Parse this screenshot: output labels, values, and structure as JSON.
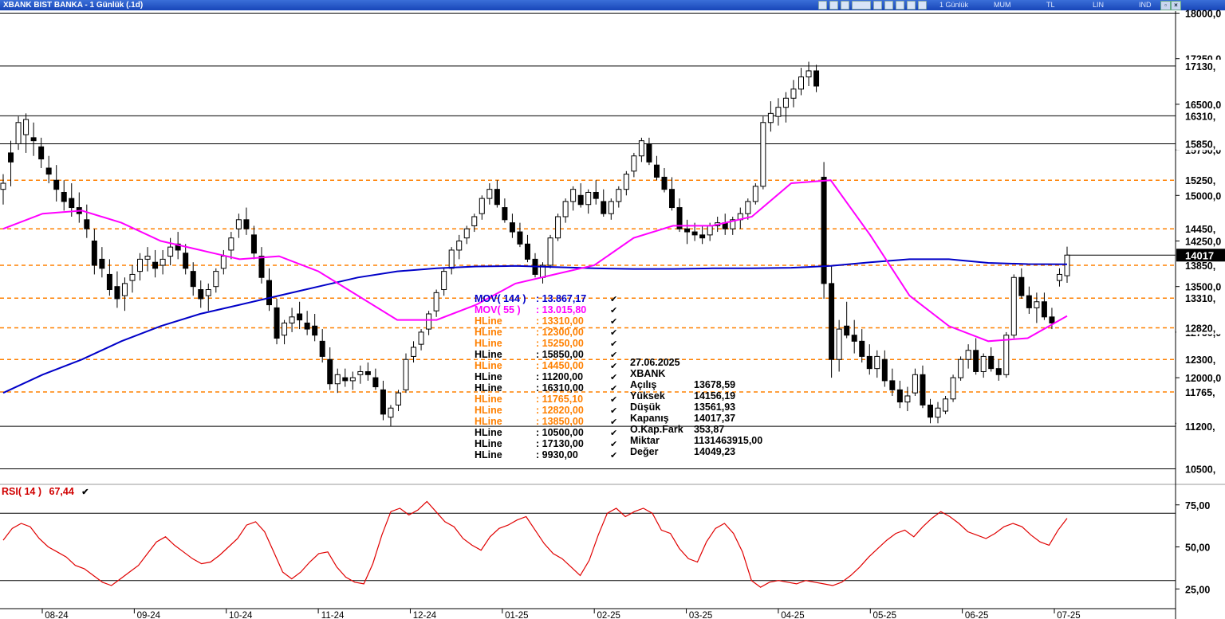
{
  "window": {
    "title": "XBANK BIST BANKA - 1 Günlük (.1d)",
    "options": [
      "1 Günlük",
      "MUM",
      "TL",
      "LIN",
      "IND"
    ]
  },
  "chart_data": [
    {
      "type": "candlestick",
      "symbol": "XBANK",
      "scale": {
        "min": 10200,
        "max": 18000
      },
      "price_ticks": [
        "18000,0",
        "17250,0",
        "16500,0",
        "15750,0",
        "15000,0",
        "14250,0",
        "13500,0",
        "12750,0",
        "12000,0",
        "11250,0"
      ],
      "x_ticks": [
        "08-24",
        "09-24",
        "10-24",
        "11-24",
        "12-24",
        "01-25",
        "02-25",
        "03-25",
        "04-25",
        "05-25",
        "06-25",
        "07-25"
      ],
      "last_price_label": "14017",
      "ohlc": [
        [
          15100,
          15350,
          14850,
          15200
        ],
        [
          15700,
          15900,
          15150,
          15550
        ],
        [
          15850,
          16300,
          15750,
          16200
        ],
        [
          16000,
          16350,
          15700,
          16250
        ],
        [
          15950,
          16200,
          15650,
          15900
        ],
        [
          15800,
          15950,
          15450,
          15600
        ],
        [
          15450,
          15650,
          15200,
          15350
        ],
        [
          15250,
          15500,
          14900,
          15100
        ],
        [
          15050,
          15250,
          14750,
          14900
        ],
        [
          14950,
          15200,
          14650,
          14800
        ],
        [
          14800,
          15050,
          14550,
          14700
        ],
        [
          14600,
          14850,
          14300,
          14450
        ],
        [
          14250,
          14450,
          13700,
          13850
        ],
        [
          13950,
          14150,
          13650,
          13800
        ],
        [
          13700,
          13950,
          13350,
          13450
        ],
        [
          13500,
          13750,
          13150,
          13300
        ],
        [
          13350,
          13650,
          13100,
          13550
        ],
        [
          13600,
          13850,
          13400,
          13700
        ],
        [
          13750,
          14050,
          13600,
          13950
        ],
        [
          13950,
          14150,
          13750,
          14000
        ],
        [
          13900,
          14100,
          13650,
          13800
        ],
        [
          13850,
          14100,
          13700,
          13950
        ],
        [
          14000,
          14300,
          13850,
          14150
        ],
        [
          14200,
          14400,
          13950,
          14100
        ],
        [
          14050,
          14200,
          13700,
          13800
        ],
        [
          13750,
          13900,
          13350,
          13500
        ],
        [
          13450,
          13600,
          13150,
          13300
        ],
        [
          13350,
          13550,
          13100,
          13450
        ],
        [
          13500,
          13800,
          13400,
          13750
        ],
        [
          13800,
          14100,
          13700,
          14000
        ],
        [
          14100,
          14400,
          13950,
          14300
        ],
        [
          14450,
          14700,
          14300,
          14600
        ],
        [
          14600,
          14800,
          14350,
          14450
        ],
        [
          14350,
          14500,
          13950,
          14050
        ],
        [
          14000,
          14150,
          13550,
          13650
        ],
        [
          13600,
          13800,
          13100,
          13200
        ],
        [
          13150,
          13300,
          12550,
          12650
        ],
        [
          12700,
          12950,
          12550,
          12900
        ],
        [
          12900,
          13150,
          12750,
          13000
        ],
        [
          13050,
          13250,
          12800,
          12950
        ],
        [
          12900,
          13100,
          12700,
          12800
        ],
        [
          12850,
          13050,
          12600,
          12700
        ],
        [
          12600,
          12800,
          12250,
          12350
        ],
        [
          12300,
          12500,
          11800,
          11900
        ],
        [
          11900,
          12150,
          11750,
          12050
        ],
        [
          12000,
          12150,
          11850,
          11950
        ],
        [
          11950,
          12100,
          11800,
          12000
        ],
        [
          12050,
          12200,
          11900,
          12100
        ],
        [
          12100,
          12250,
          11950,
          12050
        ],
        [
          12000,
          12150,
          11800,
          11850
        ],
        [
          11800,
          11950,
          11300,
          11400
        ],
        [
          11350,
          11550,
          11200,
          11500
        ],
        [
          11550,
          11800,
          11450,
          11750
        ],
        [
          11800,
          12400,
          11750,
          12300
        ],
        [
          12350,
          12600,
          12250,
          12500
        ],
        [
          12550,
          12800,
          12450,
          12750
        ],
        [
          12800,
          13100,
          12700,
          13050
        ],
        [
          13100,
          13450,
          13000,
          13400
        ],
        [
          13450,
          13800,
          13350,
          13750
        ],
        [
          13800,
          14150,
          13700,
          14100
        ],
        [
          14100,
          14350,
          13950,
          14250
        ],
        [
          14300,
          14500,
          14200,
          14450
        ],
        [
          14500,
          14700,
          14400,
          14650
        ],
        [
          14700,
          15000,
          14600,
          14950
        ],
        [
          14950,
          15200,
          14850,
          15100
        ],
        [
          15100,
          15250,
          14800,
          14850
        ],
        [
          14800,
          14950,
          14550,
          14600
        ],
        [
          14550,
          14700,
          14300,
          14400
        ],
        [
          14400,
          14550,
          14150,
          14200
        ],
        [
          14200,
          14350,
          13900,
          13950
        ],
        [
          13950,
          14050,
          13650,
          13700
        ],
        [
          13650,
          13900,
          13550,
          13850
        ],
        [
          13850,
          14350,
          13800,
          14300
        ],
        [
          14300,
          14700,
          14250,
          14650
        ],
        [
          14650,
          14950,
          14550,
          14900
        ],
        [
          14900,
          15150,
          14750,
          15100
        ],
        [
          15000,
          15200,
          14800,
          14850
        ],
        [
          14850,
          15100,
          14700,
          15050
        ],
        [
          15050,
          15250,
          14850,
          14950
        ],
        [
          14900,
          15100,
          14650,
          14700
        ],
        [
          14700,
          14950,
          14600,
          14900
        ],
        [
          14900,
          15150,
          14800,
          15100
        ],
        [
          15100,
          15400,
          15000,
          15350
        ],
        [
          15400,
          15700,
          15300,
          15650
        ],
        [
          15650,
          15950,
          15550,
          15900
        ],
        [
          15850,
          15950,
          15500,
          15550
        ],
        [
          15500,
          15650,
          15250,
          15300
        ],
        [
          15300,
          15450,
          15050,
          15100
        ],
        [
          15100,
          15300,
          14750,
          14800
        ],
        [
          14800,
          14950,
          14400,
          14450
        ],
        [
          14450,
          14600,
          14200,
          14400
        ],
        [
          14400,
          14550,
          14250,
          14350
        ],
        [
          14350,
          14500,
          14200,
          14300
        ],
        [
          14350,
          14550,
          14250,
          14500
        ],
        [
          14500,
          14650,
          14400,
          14550
        ],
        [
          14550,
          14700,
          14350,
          14450
        ],
        [
          14450,
          14650,
          14350,
          14600
        ],
        [
          14600,
          14800,
          14450,
          14700
        ],
        [
          14700,
          14950,
          14600,
          14900
        ],
        [
          14900,
          15200,
          14850,
          15150
        ],
        [
          15150,
          16300,
          15100,
          16200
        ],
        [
          16200,
          16550,
          16050,
          16350
        ],
        [
          16300,
          16600,
          16150,
          16450
        ],
        [
          16450,
          16700,
          16200,
          16600
        ],
        [
          16600,
          16900,
          16450,
          16750
        ],
        [
          16750,
          17100,
          16650,
          16950
        ],
        [
          16950,
          17200,
          16800,
          17050
        ],
        [
          17050,
          17150,
          16700,
          16800
        ],
        [
          15300,
          15550,
          13300,
          13550
        ],
        [
          13550,
          13850,
          12000,
          12300
        ],
        [
          12300,
          12950,
          12100,
          12800
        ],
        [
          12850,
          13250,
          12650,
          12700
        ],
        [
          12700,
          12950,
          12400,
          12600
        ],
        [
          12600,
          12800,
          12250,
          12350
        ],
        [
          12350,
          12550,
          12050,
          12150
        ],
        [
          12150,
          12450,
          12000,
          12350
        ],
        [
          12300,
          12450,
          11850,
          11950
        ],
        [
          11950,
          12150,
          11700,
          11800
        ],
        [
          11800,
          11950,
          11500,
          11600
        ],
        [
          11600,
          11850,
          11450,
          11700
        ],
        [
          11750,
          12150,
          11700,
          12050
        ],
        [
          12050,
          12200,
          11500,
          11550
        ],
        [
          11550,
          11650,
          11250,
          11350
        ],
        [
          11350,
          11600,
          11250,
          11500
        ],
        [
          11450,
          11700,
          11400,
          11650
        ],
        [
          11650,
          12050,
          11600,
          12000
        ],
        [
          12000,
          12350,
          11950,
          12300
        ],
        [
          12300,
          12550,
          12150,
          12450
        ],
        [
          12450,
          12650,
          12050,
          12100
        ],
        [
          12100,
          12400,
          12000,
          12350
        ],
        [
          12350,
          12500,
          12100,
          12150
        ],
        [
          12150,
          12300,
          11950,
          12050
        ],
        [
          12050,
          12750,
          12000,
          12700
        ],
        [
          12700,
          13700,
          12650,
          13650
        ],
        [
          13650,
          13800,
          13300,
          13350
        ],
        [
          13350,
          13500,
          13050,
          13150
        ],
        [
          13150,
          13400,
          12900,
          13250
        ],
        [
          13250,
          13400,
          12950,
          13000
        ],
        [
          13000,
          13150,
          12800,
          12900
        ],
        [
          13600,
          13800,
          13500,
          13700
        ],
        [
          13678.59,
          14156.19,
          13561.93,
          14017.37
        ]
      ],
      "series": [
        {
          "name": "MOV( 144 )",
          "color": "#0000c8",
          "values": [
            11750,
            12050,
            12300,
            12600,
            12850,
            13050,
            13200,
            13350,
            13500,
            13650,
            13750,
            13800,
            13830,
            13840,
            13820,
            13800,
            13790,
            13790,
            13800,
            13800,
            13810,
            13840,
            13900,
            13950,
            13950,
            13890,
            13870,
            13867.17
          ]
        },
        {
          "name": "MOV( 55 )",
          "color": "#ff00ff",
          "values": [
            14450,
            14700,
            14750,
            14550,
            14250,
            14100,
            13950,
            14000,
            13750,
            13350,
            12950,
            12950,
            13200,
            13550,
            13700,
            13850,
            14300,
            14500,
            14500,
            14650,
            15200,
            15250,
            14350,
            13350,
            12850,
            12600,
            12650,
            13015.8
          ]
        }
      ],
      "hlines": {
        "solid": [
          18000,
          17130,
          16310,
          15850,
          11200,
          10500
        ],
        "dashed": [
          15250,
          14450,
          13850,
          13310,
          12820,
          12300,
          11765
        ]
      },
      "right_labels": [
        {
          "text": "17130,",
          "value": 17130
        },
        {
          "text": "16310,",
          "value": 16310
        },
        {
          "text": "15850,",
          "value": 15850
        },
        {
          "text": "15250,",
          "value": 15250
        },
        {
          "text": "14450,",
          "value": 14450
        },
        {
          "text": "13850,",
          "value": 13850
        },
        {
          "text": "13310,",
          "value": 13310
        },
        {
          "text": "12820,",
          "value": 12820
        },
        {
          "text": "12300,",
          "value": 12300
        },
        {
          "text": "11765,",
          "value": 11765
        },
        {
          "text": "11200,",
          "value": 11200
        },
        {
          "text": "10500,",
          "value": 10500
        }
      ],
      "colors": {
        "up": "#ffffff",
        "down": "#000000",
        "dashed": "#ff8000",
        "last_price_bg": "#000000"
      }
    },
    {
      "type": "line",
      "name": "RSI( 14 )",
      "value_label": "67,44",
      "color": "#e00000",
      "ylim": [
        15,
        80
      ],
      "y_ticks": [
        "75,00",
        "50,00",
        "25,00"
      ],
      "bands": [
        70,
        30
      ],
      "values": [
        54,
        61,
        64,
        62,
        55,
        50,
        47,
        44,
        39,
        37,
        33,
        29,
        27,
        31,
        35,
        39,
        46,
        53,
        56,
        51,
        47,
        43,
        40,
        41,
        45,
        50,
        55,
        63,
        65,
        59,
        47,
        35,
        31,
        35,
        41,
        46,
        47,
        38,
        32,
        29,
        28,
        40,
        57,
        71,
        73,
        69,
        72,
        77,
        71,
        65,
        62,
        55,
        51,
        48,
        56,
        61,
        63,
        66,
        68,
        60,
        52,
        46,
        43,
        38,
        33,
        42,
        57,
        70,
        73,
        68,
        71,
        73,
        70,
        60,
        58,
        49,
        43,
        41,
        53,
        61,
        64,
        58,
        47,
        30,
        26,
        29,
        30,
        29,
        28,
        30,
        29,
        28,
        27,
        29,
        33,
        38,
        44,
        49,
        54,
        58,
        60,
        56,
        62,
        67,
        71,
        68,
        64,
        59,
        57,
        55,
        58,
        62,
        64,
        62,
        57,
        53,
        51,
        60,
        67
      ]
    }
  ],
  "info_panel": {
    "lines": [
      {
        "label": "MOV( 144 )",
        "value": ": 13.867,17",
        "color": "#0000c8"
      },
      {
        "label": "MOV( 55 )",
        "value": ": 13.015,80",
        "color": "#ff00ff"
      },
      {
        "label": "HLine",
        "value": ": 13310,00",
        "color": "#ff8000"
      },
      {
        "label": "HLine",
        "value": ": 12300,00",
        "color": "#ff8000"
      },
      {
        "label": "HLine",
        "value": ": 15250,00",
        "color": "#ff8000"
      },
      {
        "label": "HLine",
        "value": ": 15850,00",
        "color": "#000000"
      },
      {
        "label": "HLine",
        "value": ": 14450,00",
        "color": "#ff8000"
      },
      {
        "label": "HLine",
        "value": ": 11200,00",
        "color": "#000000"
      },
      {
        "label": "HLine",
        "value": ": 16310,00",
        "color": "#000000"
      },
      {
        "label": "HLine",
        "value": ": 11765,10",
        "color": "#ff8000"
      },
      {
        "label": "HLine",
        "value": ": 12820,00",
        "color": "#ff8000"
      },
      {
        "label": "HLine",
        "value": ": 13850,00",
        "color": "#ff8000"
      },
      {
        "label": "HLine",
        "value": ": 10500,00",
        "color": "#000000"
      },
      {
        "label": "HLine",
        "value": ": 17130,00",
        "color": "#000000"
      },
      {
        "label": "HLine",
        "value": ": 9930,00",
        "color": "#000000"
      }
    ],
    "date": "27.06.2025",
    "symbol": "XBANK",
    "ohlc_rows": [
      {
        "label": "Açılış",
        "value": "13678,59"
      },
      {
        "label": "Yüksek",
        "value": "14156,19"
      },
      {
        "label": "Düşük",
        "value": "13561,93"
      },
      {
        "label": "Kapanış",
        "value": "14017,37"
      },
      {
        "label": "O.Kap.Fark",
        "value": "353,87"
      },
      {
        "label": "Miktar",
        "value": "1131463915,00"
      },
      {
        "label": "Değer",
        "value": "14049,23"
      }
    ]
  }
}
